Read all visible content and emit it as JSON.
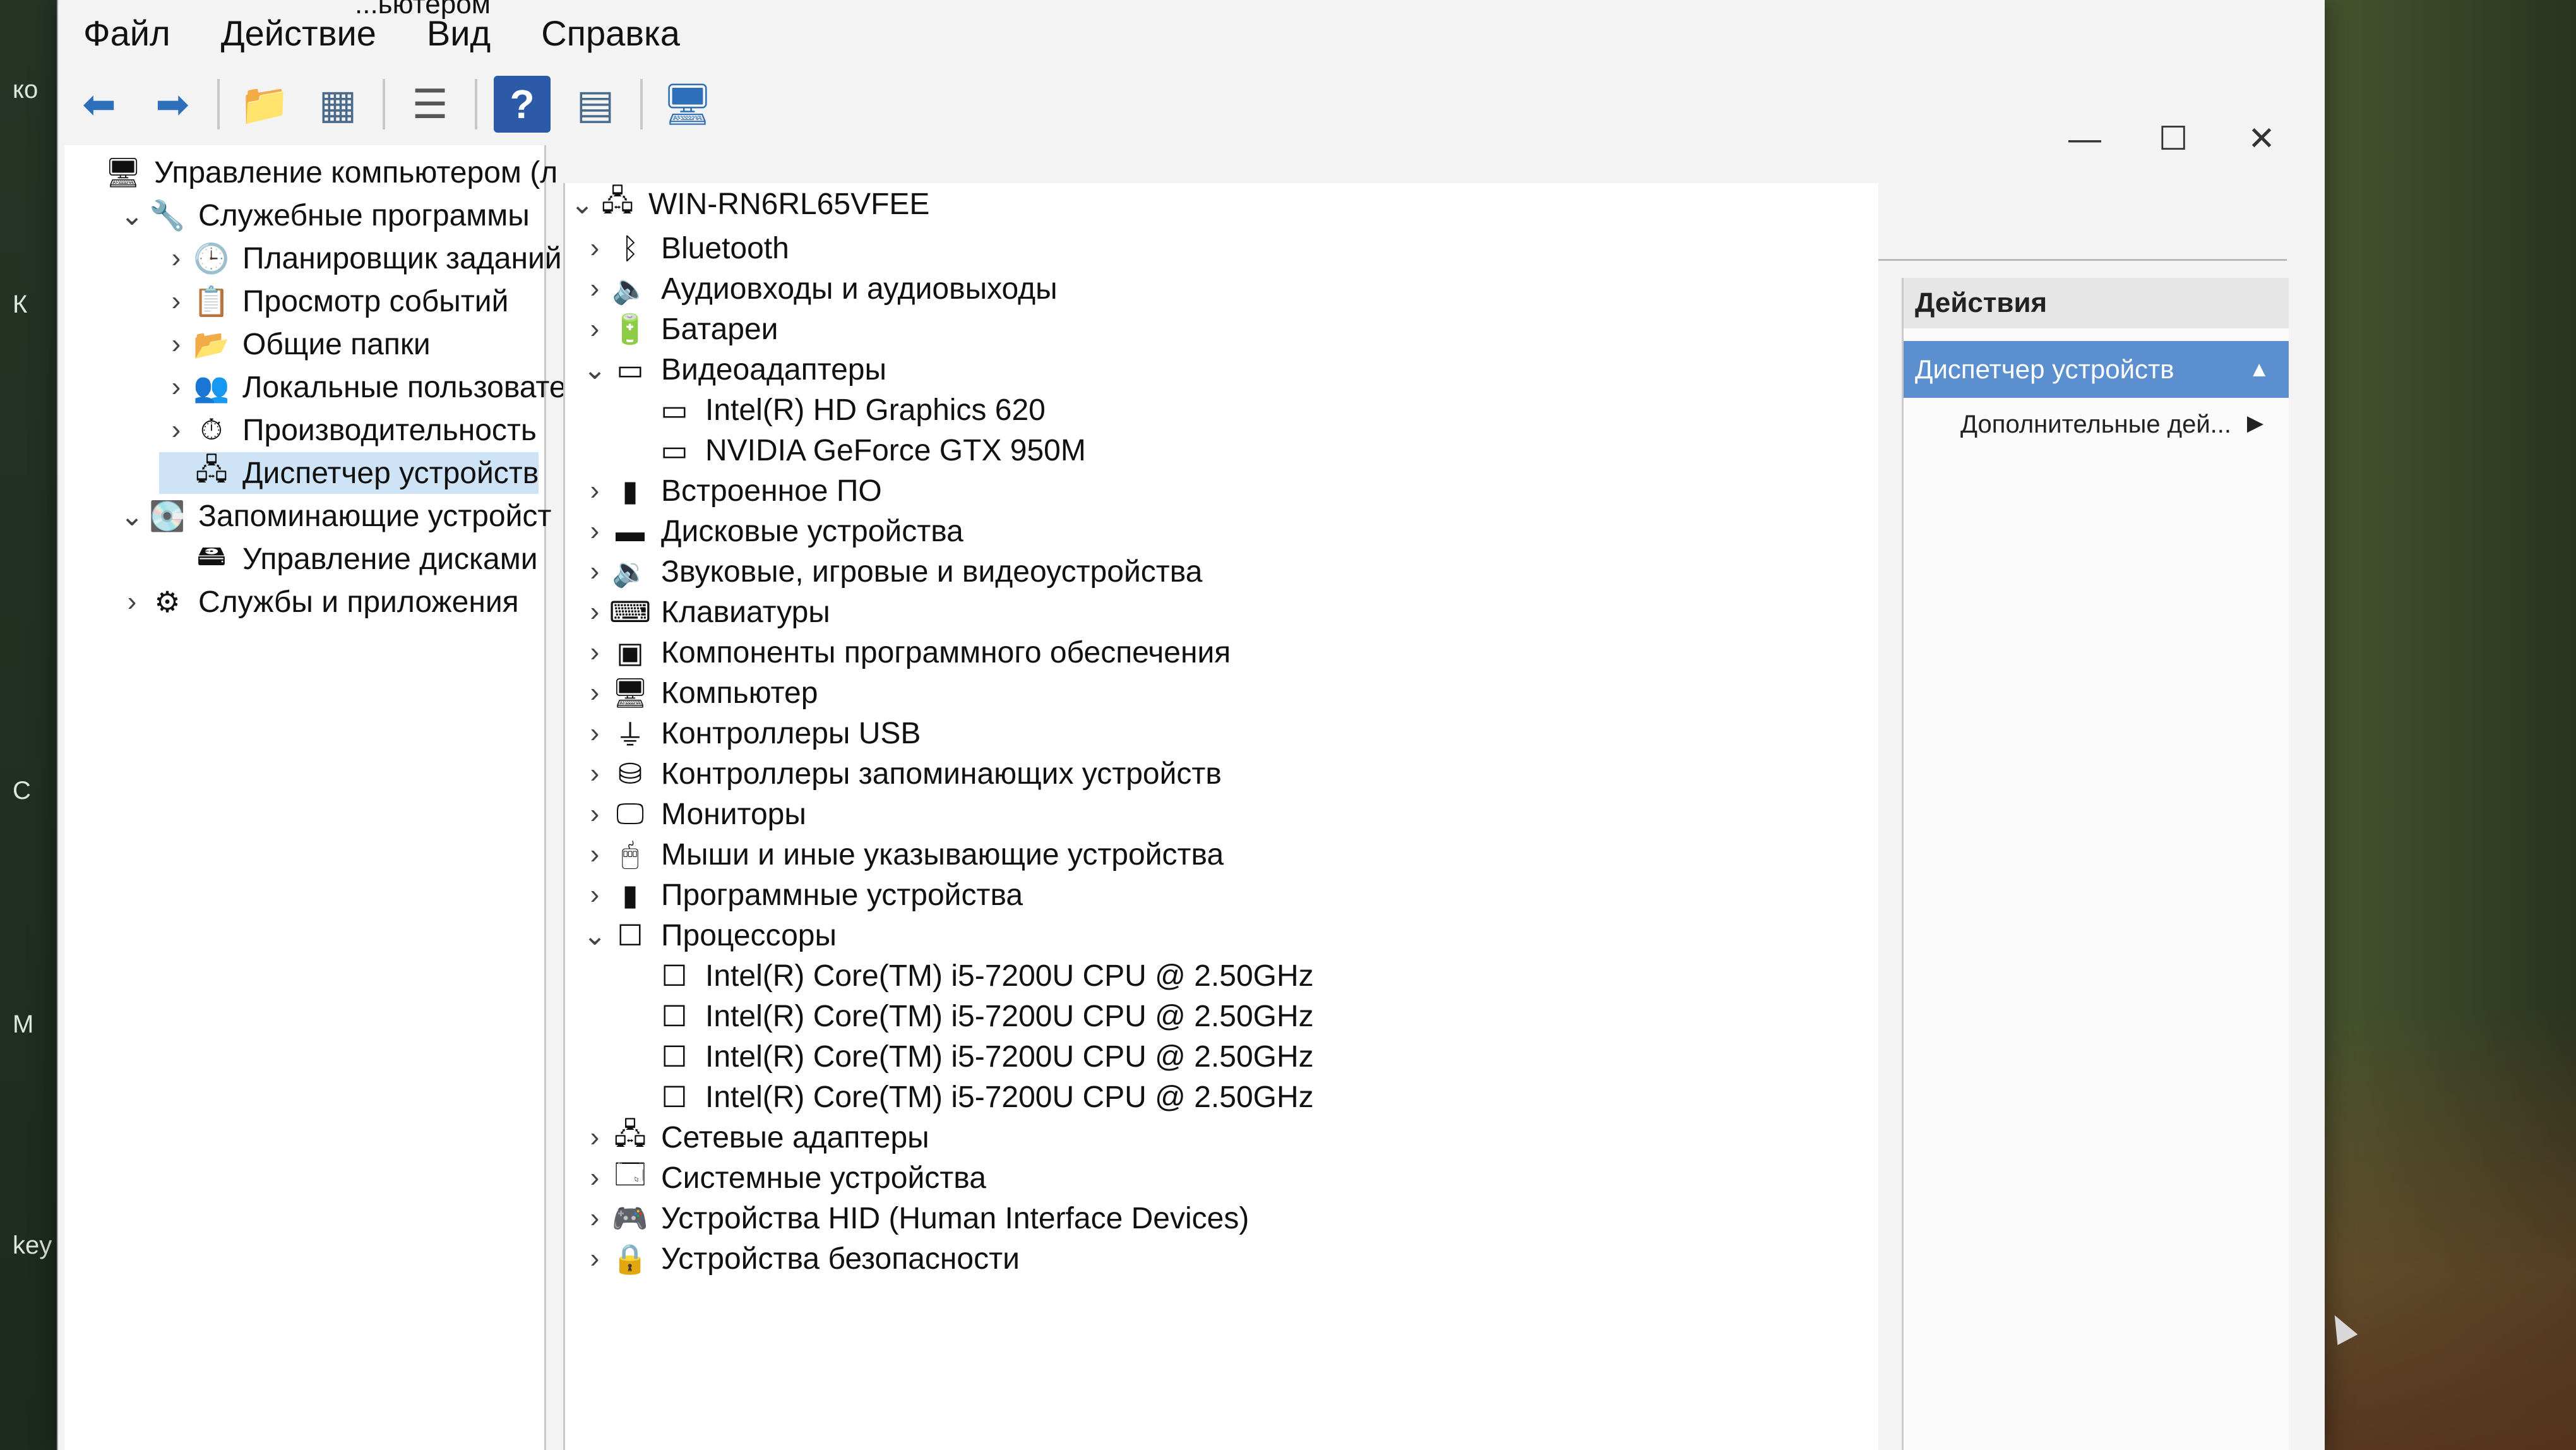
{
  "window": {
    "title": "...ьютером"
  },
  "menu": [
    "Файл",
    "Действие",
    "Вид",
    "Справка"
  ],
  "toolbar_icons": [
    "back-arrow-icon",
    "forward-arrow-icon",
    "folder-up-icon",
    "console-tree-icon",
    "properties-icon",
    "help-icon",
    "action-pane-icon",
    "monitor-icon"
  ],
  "desktop_labels": [
    "ко",
    "К",
    "key",
    "С",
    "М"
  ],
  "left_tree": [
    {
      "label": "Управление компьютером (л",
      "level": 0,
      "expand": "",
      "icon": "computer-management-icon"
    },
    {
      "label": "Служебные программы",
      "level": 1,
      "expand": "v",
      "icon": "tools-icon"
    },
    {
      "label": "Планировщик заданий",
      "level": 2,
      "expand": ">",
      "icon": "clock-icon"
    },
    {
      "label": "Просмотр событий",
      "level": 2,
      "expand": ">",
      "icon": "event-viewer-icon"
    },
    {
      "label": "Общие папки",
      "level": 2,
      "expand": ">",
      "icon": "shared-folders-icon"
    },
    {
      "label": "Локальные пользовате",
      "level": 2,
      "expand": ">",
      "icon": "users-icon"
    },
    {
      "label": "Производительность",
      "level": 2,
      "expand": ">",
      "icon": "performance-icon"
    },
    {
      "label": "Диспетчер устройств",
      "level": 2,
      "expand": "",
      "icon": "device-manager-icon",
      "selected": true
    },
    {
      "label": "Запоминающие устройст",
      "level": 1,
      "expand": "v",
      "icon": "storage-icon"
    },
    {
      "label": "Управление дисками",
      "level": 2,
      "expand": "",
      "icon": "disk-management-icon"
    },
    {
      "label": "Службы и приложения",
      "level": 1,
      "expand": ">",
      "icon": "services-icon"
    }
  ],
  "device_tree": {
    "root": "WIN-RN6RL65VFEE",
    "items": [
      {
        "label": "Bluetooth",
        "level": 1,
        "expand": ">",
        "icon": "bluetooth-icon"
      },
      {
        "label": "Аудиовходы и аудиовыходы",
        "level": 1,
        "expand": ">",
        "icon": "speaker-icon"
      },
      {
        "label": "Батареи",
        "level": 1,
        "expand": ">",
        "icon": "battery-icon"
      },
      {
        "label": "Видеоадаптеры",
        "level": 1,
        "expand": "v",
        "icon": "display-adapter-icon"
      },
      {
        "label": "Intel(R) HD Graphics 620",
        "level": 2,
        "expand": "",
        "icon": "display-adapter-icon"
      },
      {
        "label": "NVIDIA GeForce GTX 950M",
        "level": 2,
        "expand": "",
        "icon": "display-adapter-icon"
      },
      {
        "label": "Встроенное ПО",
        "level": 1,
        "expand": ">",
        "icon": "firmware-icon"
      },
      {
        "label": "Дисковые устройства",
        "level": 1,
        "expand": ">",
        "icon": "disk-drive-icon"
      },
      {
        "label": "Звуковые, игровые и видеоустройства",
        "level": 1,
        "expand": ">",
        "icon": "sound-icon"
      },
      {
        "label": "Клавиатуры",
        "level": 1,
        "expand": ">",
        "icon": "keyboard-icon"
      },
      {
        "label": "Компоненты программного обеспечения",
        "level": 1,
        "expand": ">",
        "icon": "software-component-icon"
      },
      {
        "label": "Компьютер",
        "level": 1,
        "expand": ">",
        "icon": "computer-icon"
      },
      {
        "label": "Контроллеры USB",
        "level": 1,
        "expand": ">",
        "icon": "usb-icon"
      },
      {
        "label": "Контроллеры запоминающих устройств",
        "level": 1,
        "expand": ">",
        "icon": "storage-controller-icon"
      },
      {
        "label": "Мониторы",
        "level": 1,
        "expand": ">",
        "icon": "monitor-icon"
      },
      {
        "label": "Мыши и иные указывающие устройства",
        "level": 1,
        "expand": ">",
        "icon": "mouse-icon"
      },
      {
        "label": "Программные устройства",
        "level": 1,
        "expand": ">",
        "icon": "software-device-icon"
      },
      {
        "label": "Процессоры",
        "level": 1,
        "expand": "v",
        "icon": "processor-icon"
      },
      {
        "label": "Intel(R) Core(TM) i5-7200U CPU @ 2.50GHz",
        "level": 2,
        "expand": "",
        "icon": "processor-icon"
      },
      {
        "label": "Intel(R) Core(TM) i5-7200U CPU @ 2.50GHz",
        "level": 2,
        "expand": "",
        "icon": "processor-icon"
      },
      {
        "label": "Intel(R) Core(TM) i5-7200U CPU @ 2.50GHz",
        "level": 2,
        "expand": "",
        "icon": "processor-icon"
      },
      {
        "label": "Intel(R) Core(TM) i5-7200U CPU @ 2.50GHz",
        "level": 2,
        "expand": "",
        "icon": "processor-icon"
      },
      {
        "label": "Сетевые адаптеры",
        "level": 1,
        "expand": ">",
        "icon": "network-adapter-icon"
      },
      {
        "label": "Системные устройства",
        "level": 1,
        "expand": ">",
        "icon": "system-devices-icon"
      },
      {
        "label": "Устройства HID (Human Interface Devices)",
        "level": 1,
        "expand": ">",
        "icon": "hid-icon"
      },
      {
        "label": "Устройства безопасности",
        "level": 1,
        "expand": ">",
        "icon": "security-device-icon"
      }
    ]
  },
  "actions": {
    "header": "Действия",
    "selected": "Диспетчер устройств",
    "more": "Дополнительные дей..."
  },
  "colors": {
    "selection_bg": "#cfe3f7",
    "actions_selected_bg": "#5b8fd0",
    "window_bg": "#f3f3f3"
  }
}
